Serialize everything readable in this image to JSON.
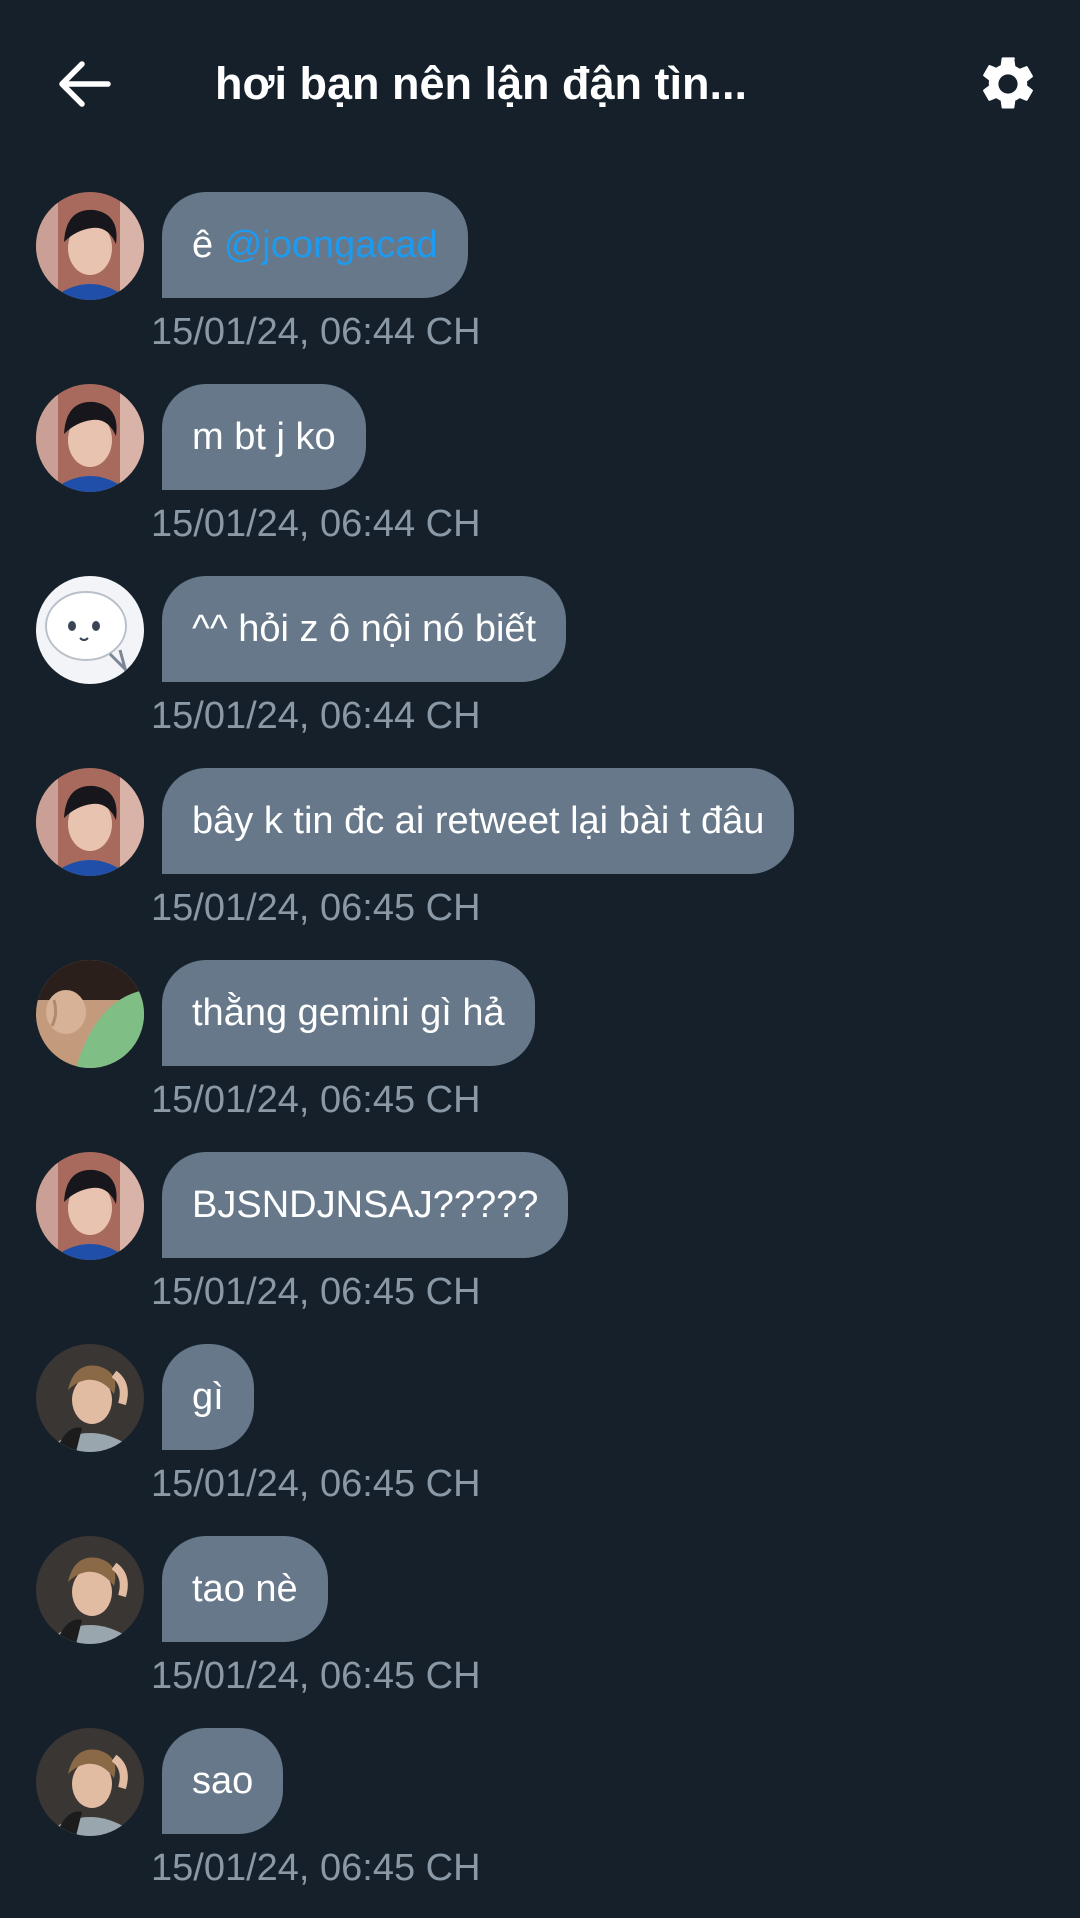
{
  "header": {
    "title": "hơi bạn nên lận đận tìn...",
    "back_icon": "arrow-left-icon",
    "settings_icon": "gear-icon"
  },
  "colors": {
    "background": "#15202b",
    "bubble": "#66788a",
    "timestamp": "#8b98a5",
    "mention": "#1d9bf0"
  },
  "messages": [
    {
      "avatar": "avatar-dark-hair-boy",
      "text": "ê ",
      "mention": "@joongacad",
      "time": "15/01/24, 06:44 CH"
    },
    {
      "avatar": "avatar-dark-hair-boy",
      "text": "m bt j ko",
      "time": "15/01/24, 06:44 CH"
    },
    {
      "avatar": "avatar-white-cartoon",
      "text": "^^ hỏi z ô nội nó biết",
      "time": "15/01/24, 06:44 CH"
    },
    {
      "avatar": "avatar-dark-hair-boy",
      "text": "bây k tin đc ai retweet lại bài t đâu",
      "time": "15/01/24, 06:45 CH"
    },
    {
      "avatar": "avatar-skin-green",
      "text": "thằng gemini gì hả",
      "time": "15/01/24, 06:45 CH"
    },
    {
      "avatar": "avatar-dark-hair-boy",
      "text": "BJSNDJNSAJ?????",
      "time": "15/01/24, 06:45 CH"
    },
    {
      "avatar": "avatar-light-hair-boy",
      "text": "gì",
      "time": "15/01/24, 06:45 CH"
    },
    {
      "avatar": "avatar-light-hair-boy",
      "text": "tao nè",
      "time": "15/01/24, 06:45 CH"
    },
    {
      "avatar": "avatar-light-hair-boy",
      "text": "sao",
      "time": "15/01/24, 06:45 CH"
    }
  ]
}
